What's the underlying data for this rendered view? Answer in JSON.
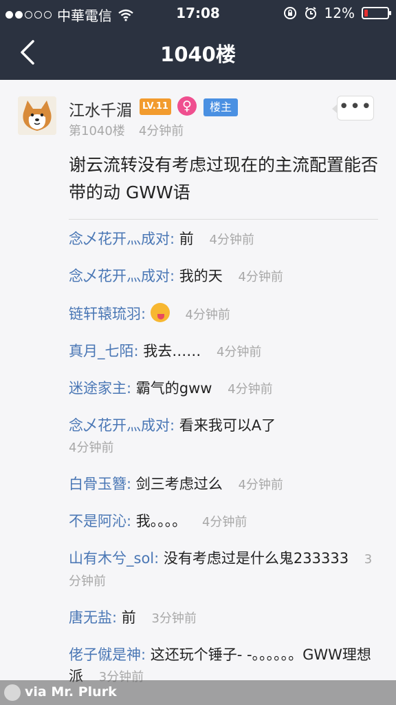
{
  "status_bar": {
    "carrier": "中華電信",
    "time": "17:08",
    "battery": "12%"
  },
  "nav": {
    "title": "1040楼"
  },
  "post": {
    "username": "江水千湄",
    "level": "LV.11",
    "gender_symbol": "♀",
    "owner_badge": "楼主",
    "floor": "第1040楼",
    "time": "4分钟前",
    "content": "谢云流转没有考虑过现在的主流配置能否带的动 GWW语"
  },
  "comments": [
    {
      "author": "念乄花开灬成对:",
      "text": "前",
      "time": "4分钟前"
    },
    {
      "author": "念乄花开灬成对:",
      "text": "我的天",
      "time": "4分钟前"
    },
    {
      "author": "链轩辕琉羽:",
      "text": "",
      "emoji": "yum-emoji",
      "time": "4分钟前"
    },
    {
      "author": "真月_七陌:",
      "text": "我去……",
      "time": "4分钟前"
    },
    {
      "author": "迷途家主:",
      "text": "霸气的gww",
      "time": "4分钟前"
    },
    {
      "author": "念乄花开灬成对:",
      "text": "看来我可以A了",
      "time": "4分钟前"
    },
    {
      "author": "白骨玉簪:",
      "text": "剑三考虑过么",
      "time": "4分钟前"
    },
    {
      "author": "不是阿沁:",
      "text": "我。。。。",
      "time": "4分钟前"
    },
    {
      "author": "山有木兮_sol:",
      "text": "没有考虑过是什么鬼233333",
      "time": "3分钟前"
    },
    {
      "author": "唐无盐:",
      "text": "前",
      "time": "3分钟前"
    },
    {
      "author": "佬子僦是神:",
      "text": "这还玩个锤子- -。。。。。。GWW理想派",
      "time": "3分钟前"
    }
  ],
  "watermark": {
    "text": "via Mr. Plurk"
  },
  "colors": {
    "topbar": "#2b3240",
    "author_link": "#4a77b5",
    "level_badge": "#f29b2e",
    "gender_badge": "#ef4f8f",
    "owner_badge": "#4a90e2",
    "battery_low": "#e63030"
  }
}
